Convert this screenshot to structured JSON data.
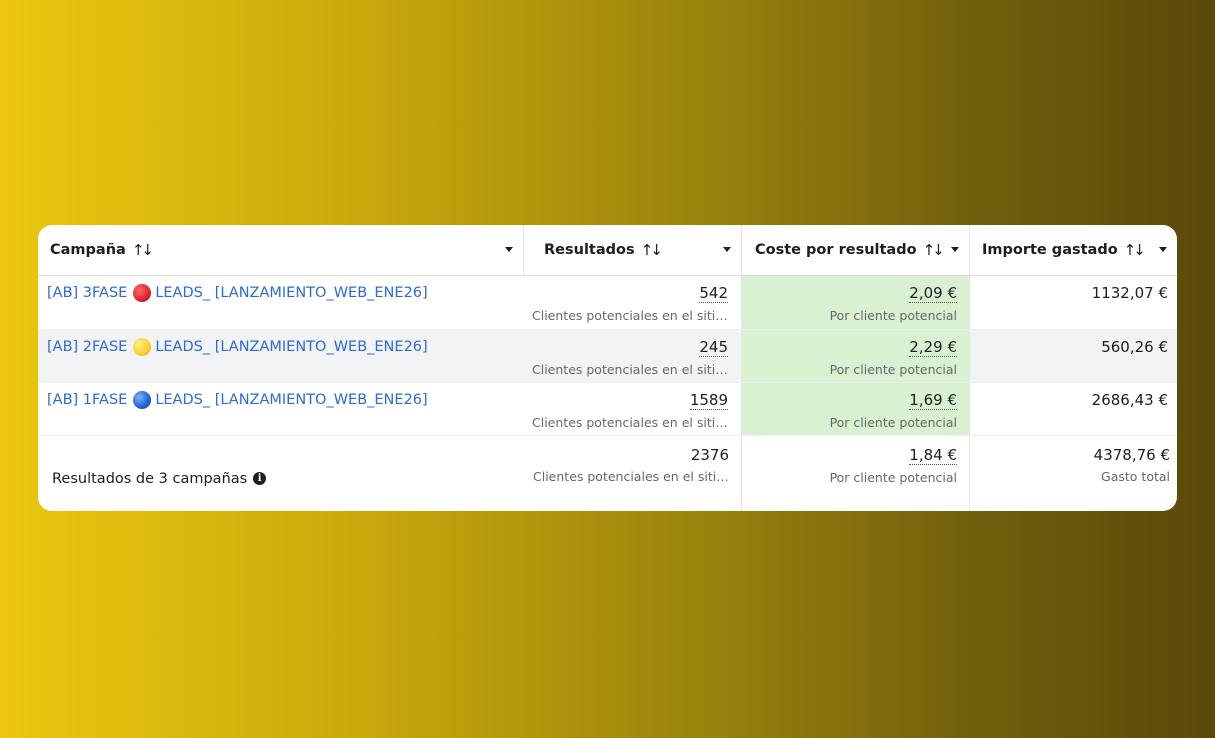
{
  "columns": [
    {
      "label": "Campaña",
      "sort_icon": "sort-arrows-icon"
    },
    {
      "label": "Resultados",
      "sort_icon": "sort-arrows-icon"
    },
    {
      "label": "Coste por resultado",
      "sort_icon": "sort-arrows-icon"
    },
    {
      "label": "Importe gastado",
      "sort_icon": "sort-arrows-icon"
    }
  ],
  "rows": [
    {
      "prefix": "[AB] 3FASE",
      "dot_color": "#e0202a",
      "suffix": "LEADS_ [LANZAMIENTO_WEB_ENE26]",
      "results": "542",
      "results_sub": "Clientes potenciales en el siti…",
      "cost": "2,09 €",
      "cost_sub": "Por cliente potencial",
      "spent": "1132,07 €"
    },
    {
      "prefix": "[AB] 2FASE",
      "dot_color": "#f7cf2a",
      "suffix": "LEADS_ [LANZAMIENTO_WEB_ENE26]",
      "results": "245",
      "results_sub": "Clientes potenciales en el siti…",
      "cost": "2,29 €",
      "cost_sub": "Por cliente potencial",
      "spent": "560,26 €"
    },
    {
      "prefix": "[AB] 1FASE",
      "dot_color": "#1f5fd6",
      "suffix": "LEADS_ [LANZAMIENTO_WEB_ENE26]",
      "results": "1589",
      "results_sub": "Clientes potenciales en el siti…",
      "cost": "1,69 €",
      "cost_sub": "Por cliente potencial",
      "spent": "2686,43 €"
    }
  ],
  "total": {
    "label": "Resultados de 3 campañas",
    "info_icon": "i",
    "results": "2376",
    "results_sub": "Clientes potenciales en el siti…",
    "cost": "1,84 €",
    "cost_sub": "Por cliente potencial",
    "spent": "4378,76 €",
    "spent_sub": "Gasto total"
  },
  "colors": {
    "link": "#2d6ad6",
    "highlight_green": "#daf1d1",
    "row_shade": "#f2f3f5"
  }
}
